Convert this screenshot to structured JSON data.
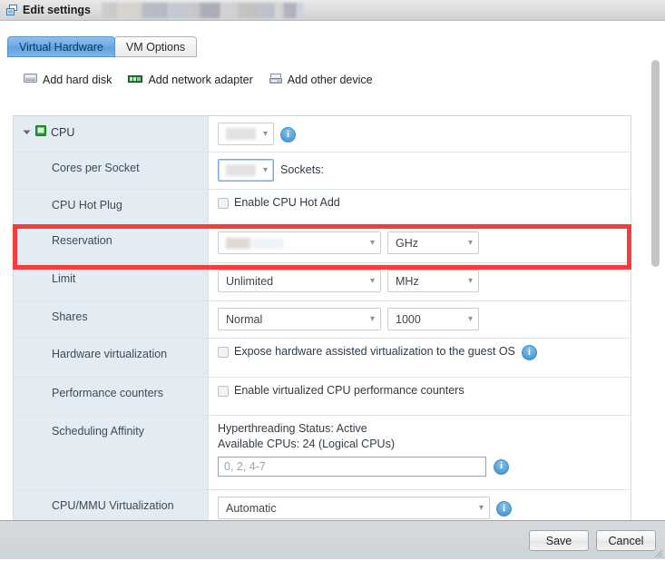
{
  "window": {
    "title": "Edit settings",
    "title_icon": "vm-settings-icon",
    "redacted_title_suffix": ""
  },
  "tabs": [
    {
      "label": "Virtual Hardware",
      "active": true
    },
    {
      "label": "VM Options",
      "active": false
    }
  ],
  "toolbar": [
    {
      "label": "Add hard disk",
      "icon": "hard-disk-icon"
    },
    {
      "label": "Add network adapter",
      "icon": "network-adapter-icon"
    },
    {
      "label": "Add other device",
      "icon": "other-device-icon"
    }
  ],
  "rows": {
    "cpu": {
      "label": "CPU",
      "value": "",
      "value_redacted": true,
      "info": "i"
    },
    "cores_per_socket": {
      "label": "Cores per Socket",
      "value": "",
      "value_redacted": true,
      "sockets_label": "Sockets:",
      "sockets_value": ""
    },
    "cpu_hot_plug": {
      "label": "CPU Hot Plug",
      "checkbox_label": "Enable CPU Hot Add",
      "checked": false
    },
    "reservation": {
      "label": "Reservation",
      "value": "",
      "value_redacted": true,
      "unit": "GHz",
      "highlighted": true
    },
    "limit": {
      "label": "Limit",
      "value": "Unlimited",
      "unit": "MHz"
    },
    "shares": {
      "label": "Shares",
      "value": "Normal",
      "amount": "1000"
    },
    "hardware_virtualization": {
      "label": "Hardware virtualization",
      "checkbox_label": "Expose hardware assisted virtualization to the guest OS",
      "checked": false,
      "info": "i"
    },
    "performance_counters": {
      "label": "Performance counters",
      "checkbox_label": "Enable virtualized CPU performance counters",
      "checked": false
    },
    "scheduling_affinity": {
      "label": "Scheduling Affinity",
      "hyperthreading_status": "Hyperthreading Status: Active",
      "available_cpus": "Available CPUs: 24 (Logical CPUs)",
      "affinity_value": "",
      "affinity_placeholder": "0, 2, 4-7",
      "info": "i"
    },
    "cpu_mmu_virtualization": {
      "label": "CPU/MMU Virtualization",
      "value": "Automatic",
      "info": "i"
    }
  },
  "footer": {
    "save_label": "Save",
    "cancel_label": "Cancel"
  },
  "colors": {
    "accent_blue": "#6aa9e4",
    "highlight_red": "#f93b3b",
    "label_column_bg": "#e3ebf3",
    "info_icon_blue": "#5aa6da"
  },
  "scrollbar": {
    "orientation": "vertical",
    "thumb_position_percent": 2
  }
}
